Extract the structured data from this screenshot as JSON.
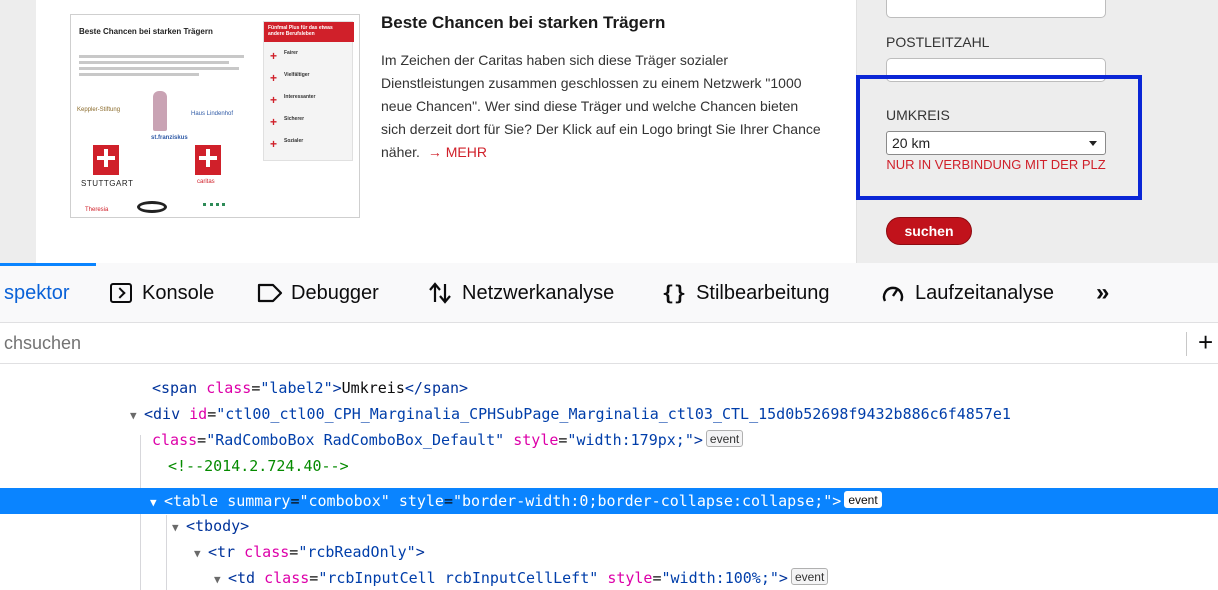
{
  "webpage": {
    "teaser_image": {
      "title": "Beste Chancen bei starken Trägern",
      "box_title": "Fünfmal Plus für das etwas andere Berufsleben",
      "box_items": [
        "Fairer",
        "Vielfältiger",
        "Interessanter",
        "Sicherer",
        "Sozialer"
      ],
      "logo_labels": [
        "Keppler-Stiftung",
        "Haus Lindenhof",
        "st.franziskus",
        "STUTTGART",
        "caritas",
        "Theresia"
      ]
    },
    "article": {
      "title": "Beste Chancen bei starken Trägern",
      "body": "Im Zeichen der Caritas haben sich diese Träger sozialer Dienstleistungen zusammen geschlossen zu einem Netzwerk \"1000 neue Chancen\". Wer sind diese Träger und welche Chancen bieten sich derzeit dort für Sie? Der Klick auf ein Logo bringt Sie Ihrer Chance näher.",
      "more_link": "→ MEHR"
    },
    "form": {
      "plz_label": "POSTLEITZAHL",
      "plz_value": "",
      "umkreis_label": "UMKREIS",
      "umkreis_selected": "20 km",
      "umkreis_note": "NUR IN VERBINDUNG MIT DER PLZ",
      "search_button": "suchen"
    },
    "colors": {
      "brand_red": "#c1121b",
      "highlight_blue": "#0a26d6"
    }
  },
  "devtools": {
    "tabs": [
      {
        "label": "spektor",
        "icon": "inspector-icon",
        "active": true
      },
      {
        "label": "Konsole",
        "icon": "console-icon"
      },
      {
        "label": "Debugger",
        "icon": "debugger-icon"
      },
      {
        "label": "Netzwerkanalyse",
        "icon": "network-icon"
      },
      {
        "label": "Stilbearbeitung",
        "icon": "style-editor-icon"
      },
      {
        "label": "Laufzeitanalyse",
        "icon": "performance-icon"
      }
    ],
    "overflow_label": "»",
    "search_placeholder": "chsuchen",
    "add_node_label": "+",
    "event_badge": "event",
    "tree": {
      "line1": {
        "open": "<span",
        "attr": "class",
        "val": "\"label2\"",
        "close": ">",
        "text": "Umkreis",
        "end": "</span>"
      },
      "line2": {
        "open": "<div",
        "attr": "id",
        "val": "\"ctl00_ctl00_CPH_Marginalia_CPHSubPage_Marginalia_ctl03_CTL_15d0b52698f9432b886c6f4857e1"
      },
      "line3": {
        "attr1": "class",
        "val1": "\"RadComboBox RadComboBox_Default\"",
        "attr2": "style",
        "val2": "\"width:179px;\"",
        "close": ">"
      },
      "line4": {
        "comment": "<!--2014.2.724.40-->"
      },
      "line5": {
        "open": "<table",
        "attr1": "summary",
        "val1": "\"combobox\"",
        "attr2": "style",
        "val2": "\"border-width:0;border-collapse:collapse;\"",
        "close": ">"
      },
      "line6": {
        "open": "<tbody>"
      },
      "line7": {
        "open": "<tr",
        "attr": "class",
        "val": "\"rcbReadOnly\"",
        "close": ">"
      },
      "line8": {
        "open": "<td",
        "attr1": "class",
        "val1": "\"rcbInputCell rcbInputCellLeft\"",
        "attr2": "style",
        "val2": "\"width:100%;\"",
        "close": ">"
      }
    }
  }
}
